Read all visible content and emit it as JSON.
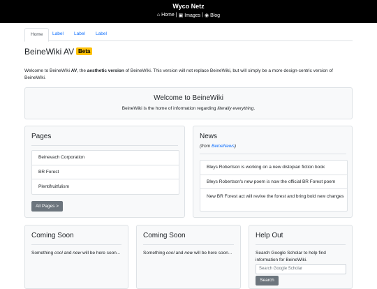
{
  "header": {
    "brand": "Wyco Netz",
    "nav": [
      {
        "icon": "home-icon",
        "label": "Home"
      },
      {
        "sep": "|"
      },
      {
        "icon": "images-icon",
        "label": "Images"
      },
      {
        "sep": "|"
      },
      {
        "icon": "rss-icon",
        "label": "Blog"
      }
    ]
  },
  "tabs": [
    "Home",
    "Label",
    "Label",
    "Label"
  ],
  "page": {
    "title": "BeineWiki AV",
    "badge": "Beta",
    "intro_p1": "Welcome to BeineWiki ",
    "intro_bold1": "AV",
    "intro_p2": ", the ",
    "intro_bold2": "aesthetic version",
    "intro_p3": " of BeineWiki. This version will not replace BeineWiki, but will simply be a more design-centric version of BeineWiki."
  },
  "welcome": {
    "heading": "Welcome to BeineWiki",
    "text_before": "BeineWiki is the home of information regarding ",
    "text_em": "literally everything",
    "text_after": "."
  },
  "pages_card": {
    "title": "Pages",
    "items": [
      "Beinevach Corporation",
      "BR Forest",
      "Plentifruitfulism"
    ],
    "button": "All Pages >"
  },
  "news_card": {
    "title": "News",
    "from_prefix": "(from ",
    "from_link": "BeineNews",
    "from_suffix": ")",
    "items": [
      "Bleys Robertson is working on a new distopian fiction book",
      "Bleys Robertson's new poem is now the official BR Forest poem",
      "New BR Forest act will revive the forest and bring bold new changes"
    ]
  },
  "coming1": {
    "title": "Coming Soon",
    "t1": "Something ",
    "em1": "cool",
    "t2": " and ",
    "em2": "new",
    "t3": " will be here soon..."
  },
  "coming2": {
    "title": "Coming Soon",
    "t1": "Something ",
    "em1": "cool",
    "t2": " and ",
    "em2": "new",
    "t3": " will be here soon..."
  },
  "help": {
    "title": "Help Out",
    "text": "Search Google Scholar to help find information for BeineWiki.",
    "placeholder": "Search Google Scholar",
    "button": "Search"
  }
}
